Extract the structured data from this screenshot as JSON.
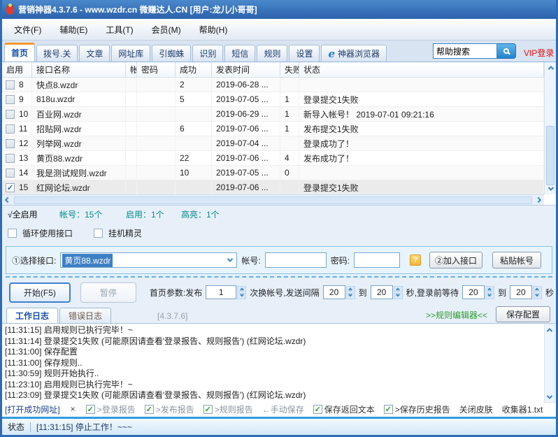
{
  "window": {
    "title": "营销神器4.3.7.6 - www.wzdr.cn 微赚达人.CN [用户:龙儿小哥哥]"
  },
  "menu": {
    "items": [
      "文件(F)",
      "辅助(E)",
      "工具(T)",
      "会员(M)",
      "帮助(H)"
    ]
  },
  "tabs": {
    "items": [
      {
        "label": "首页",
        "active": true
      },
      {
        "label": "拨号.关"
      },
      {
        "label": "文章"
      },
      {
        "label": "网址库"
      },
      {
        "label": "引蜘蛛"
      },
      {
        "label": "识别"
      },
      {
        "label": "短信"
      },
      {
        "label": "规则"
      },
      {
        "label": "设置"
      },
      {
        "label": "神器浏览器",
        "icon": "ie-icon"
      }
    ],
    "search_value": "帮助搜索",
    "vip_label": "VIP登录"
  },
  "table": {
    "columns": [
      "启用",
      "接口名称",
      "帐",
      "密码",
      "成功",
      "发表时间",
      "失败",
      "状态"
    ],
    "rows": [
      {
        "num": "8",
        "name": "快点8.wzdr",
        "account": "",
        "password": "",
        "success": "2",
        "time": "2019-06-28 ...",
        "fail": "",
        "status": "",
        "checked": false,
        "selected": false
      },
      {
        "num": "9",
        "name": "818u.wzdr",
        "account": "",
        "password": "",
        "success": "5",
        "time": "2019-07-05 ...",
        "fail": "1",
        "status": "登录提交1失败",
        "checked": false,
        "selected": false
      },
      {
        "num": "10",
        "name": "百业网.wzdr",
        "account": "",
        "password": "",
        "success": "",
        "time": "2019-06-29 ...",
        "fail": "1",
        "status": "新导入帐号！ 2019-07-01 09:21:16",
        "checked": false,
        "selected": false
      },
      {
        "num": "11",
        "name": "招贴网.wzdr",
        "account": "",
        "password": "",
        "success": "6",
        "time": "2019-07-06 ...",
        "fail": "1",
        "status": "发布提交1失败",
        "checked": false,
        "selected": false
      },
      {
        "num": "12",
        "name": "列举网.wzdr",
        "account": "",
        "password": "",
        "success": "",
        "time": "2019-07-04 ...",
        "fail": "",
        "status": "登录成功了！",
        "checked": false,
        "selected": false
      },
      {
        "num": "13",
        "name": "黄页88.wzdr",
        "account": "",
        "password": "",
        "success": "22",
        "time": "2019-07-06 ...",
        "fail": "4",
        "status": "发布成功了！",
        "checked": false,
        "selected": false
      },
      {
        "num": "14",
        "name": "我是测试规则.wzdr",
        "account": "",
        "password": "",
        "success": "10",
        "time": "2019-07-05 ...",
        "fail": "0",
        "status": "",
        "checked": false,
        "selected": false
      },
      {
        "num": "15",
        "name": "红网论坛.wzdr",
        "account": "",
        "password": "",
        "success": "",
        "time": "2019-07-06 ...",
        "fail": "",
        "status": "登录提交1失败",
        "checked": true,
        "selected": true
      }
    ]
  },
  "summary": {
    "all_enable": "√全启用",
    "accounts": "帐号：15个",
    "enabled": "启用：1个",
    "highlight": "高亮：1个",
    "accent_color": "#008b8b"
  },
  "toggles": {
    "loop_label": "循环使用接口",
    "hangup_label": "挂机精灵"
  },
  "interface_row": {
    "select_label": "①选择接口:",
    "select_value": "黄页88.wzdr",
    "account_label": "帐号:",
    "password_label": "密码:",
    "help_label": "?",
    "join_button": "②加入接口",
    "paste_button": "粘贴帐号"
  },
  "controls": {
    "start_button": "开始(F5)",
    "pause_button": "暂停",
    "segments": [
      {
        "type": "label",
        "text": "首页参数:发布"
      },
      {
        "type": "spin",
        "value": "1"
      },
      {
        "type": "label",
        "text": "次换帐号,发送间隔"
      },
      {
        "type": "spin",
        "value": "20"
      },
      {
        "type": "label",
        "text": "到"
      },
      {
        "type": "spin",
        "value": "20"
      },
      {
        "type": "label",
        "text": "秒,登录前等待"
      },
      {
        "type": "spin",
        "value": "20"
      },
      {
        "type": "label",
        "text": "到"
      },
      {
        "type": "spin",
        "value": "20"
      },
      {
        "type": "label",
        "text": "秒"
      }
    ]
  },
  "log_tabs": {
    "work": "工作日志",
    "error": "错误日志",
    "version": "[4.3.7.6]",
    "rule_editor": ">>规则编辑器<<",
    "save_config": "保存配置"
  },
  "log": {
    "lines": [
      "[11:31:15] 启用规则已执行完毕！~",
      "[11:31:14] 登录提交1失败 (可能原因请查看'登录报告、规则报告') (红网论坛.wzdr)",
      "[11:31:00] 保存配置",
      "[11:31:00] 保存规则..",
      "[11:30:59] 规则开始执行..",
      "[11:23:10] 启用规则已执行完毕！~",
      "[11:23:09] 登录提交1失败 (可能原因请查看'登录报告、规则报告') (红网论坛.wzdr)"
    ]
  },
  "log_options": [
    {
      "type": "link",
      "label": "[打开成功网址]",
      "name": "open-success-urls-link"
    },
    {
      "type": "x",
      "label": "×",
      "name": "clear-log-button"
    },
    {
      "type": "check",
      "label": ">登录报告",
      "gray": true,
      "checked": true,
      "name": "login-report-checkbox"
    },
    {
      "type": "check",
      "label": ">发布报告",
      "gray": true,
      "checked": true,
      "name": "publish-report-checkbox"
    },
    {
      "type": "check",
      "label": ">规则报告",
      "gray": true,
      "checked": true,
      "name": "rule-report-checkbox"
    },
    {
      "type": "text",
      "label": "←手动保存",
      "name": "manual-save-label"
    },
    {
      "type": "check",
      "label": "保存返回文本",
      "gray": false,
      "checked": true,
      "name": "save-return-text-checkbox"
    },
    {
      "type": "check",
      "label": ">保存历史报告",
      "gray": false,
      "checked": true,
      "name": "save-history-report-checkbox"
    },
    {
      "type": "text2",
      "label": "关闭皮肤",
      "name": "close-skin-link"
    },
    {
      "type": "text2",
      "label": "收集器1.txt",
      "name": "collector-file-link"
    }
  ],
  "statusbar": {
    "label": "状态",
    "message": "[11:31:15] 停止工作！~~~"
  }
}
